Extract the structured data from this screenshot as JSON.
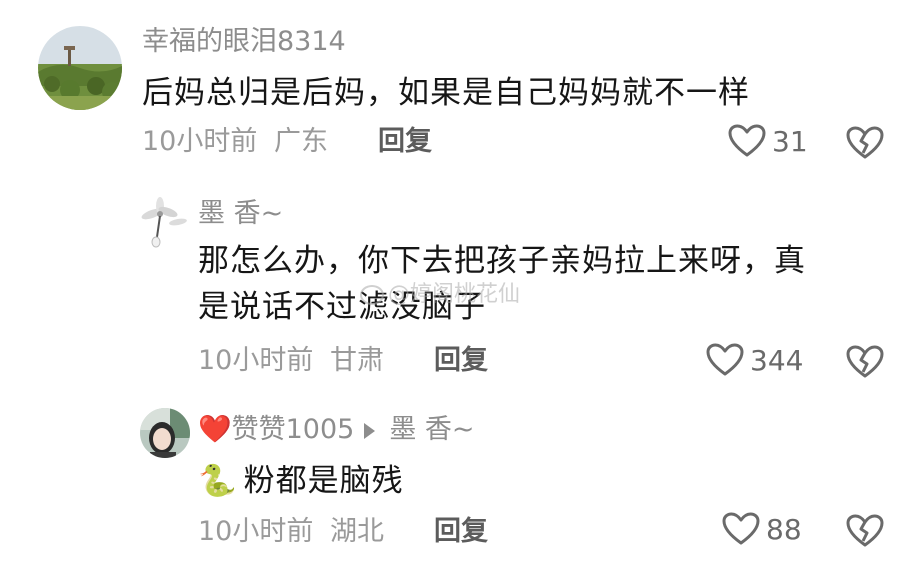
{
  "comments": [
    {
      "username": "幸福的眼泪8314",
      "text": "后妈总归是后妈，如果是自己妈妈就不一样",
      "time": "10小时前",
      "location": "广东",
      "reply_label": "回复",
      "likes": "31"
    },
    {
      "username": "墨 香~",
      "text_line1": "那怎么办，你下去把孩子亲妈拉上来呀，真",
      "text_line2": "是说话不过滤没脑子",
      "time": "10小时前",
      "location": "甘肃",
      "reply_label": "回复",
      "likes": "344"
    },
    {
      "username": "赞赞1005",
      "reply_to": "墨 香~",
      "emoji": "🐍",
      "text": "粉都是脑残",
      "time": "10小时前",
      "location": "湖北",
      "reply_label": "回复",
      "likes": "88"
    }
  ],
  "watermark": "@婷阁桃花仙",
  "colors": {
    "text": "#161616",
    "meta": "#9a9a9a",
    "username": "#8d8d8d",
    "icon": "#6a6a6a",
    "heart_badge": "#e03c3c"
  }
}
